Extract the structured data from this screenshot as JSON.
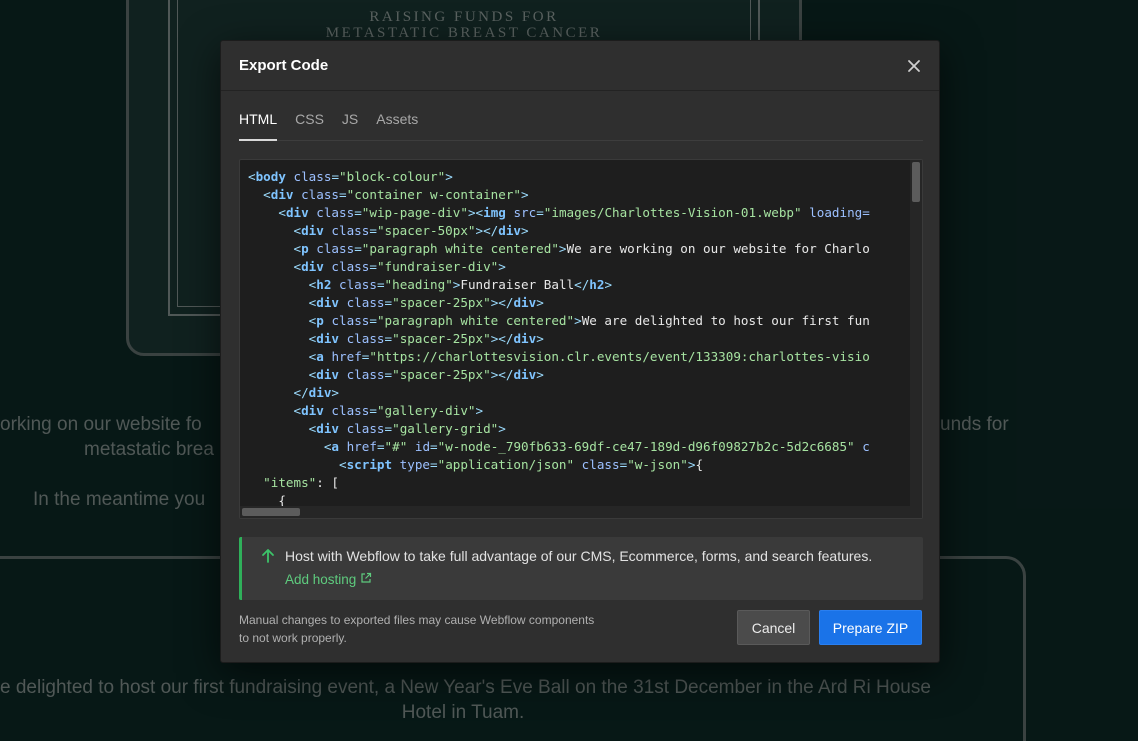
{
  "background": {
    "poster_line1": "RAISING FUNDS FOR",
    "poster_line2": "METASTATIC BREAST CANCER",
    "left_line1": "orking on our website fo",
    "left_line2": "metastatic brea",
    "left_line3": "In the meantime you",
    "right_line1": "unds for",
    "bottom_line1": "e delighted to host our first fundraising event, a New Year's Eve Ball on the 31st December in the Ard Ri House",
    "bottom_line2": "Hotel in Tuam."
  },
  "modal": {
    "title": "Export Code",
    "close_icon": "close-icon",
    "tabs": [
      {
        "label": "HTML",
        "active": true
      },
      {
        "label": "CSS",
        "active": false
      },
      {
        "label": "JS",
        "active": false
      },
      {
        "label": "Assets",
        "active": false
      }
    ],
    "code_lines": [
      [
        [
          "pu",
          "<"
        ],
        [
          "tg",
          "body"
        ],
        [
          "at",
          " class"
        ],
        [
          "pu",
          "="
        ],
        [
          "st",
          "\"block-colour\""
        ],
        [
          "pu",
          ">"
        ]
      ],
      [
        [
          "tx",
          "  "
        ],
        [
          "pu",
          "<"
        ],
        [
          "tg",
          "div"
        ],
        [
          "at",
          " class"
        ],
        [
          "pu",
          "="
        ],
        [
          "st",
          "\"container w-container\""
        ],
        [
          "pu",
          ">"
        ]
      ],
      [
        [
          "tx",
          "    "
        ],
        [
          "pu",
          "<"
        ],
        [
          "tg",
          "div"
        ],
        [
          "at",
          " class"
        ],
        [
          "pu",
          "="
        ],
        [
          "st",
          "\"wip-page-div\""
        ],
        [
          "pu",
          "><"
        ],
        [
          "tg",
          "img"
        ],
        [
          "at",
          " src"
        ],
        [
          "pu",
          "="
        ],
        [
          "st",
          "\"images/Charlottes-Vision-01.webp\""
        ],
        [
          "at",
          " loading="
        ]
      ],
      [
        [
          "tx",
          "      "
        ],
        [
          "pu",
          "<"
        ],
        [
          "tg",
          "div"
        ],
        [
          "at",
          " class"
        ],
        [
          "pu",
          "="
        ],
        [
          "st",
          "\"spacer-50px\""
        ],
        [
          "pu",
          "></"
        ],
        [
          "tg",
          "div"
        ],
        [
          "pu",
          ">"
        ]
      ],
      [
        [
          "tx",
          "      "
        ],
        [
          "pu",
          "<"
        ],
        [
          "tg",
          "p"
        ],
        [
          "at",
          " class"
        ],
        [
          "pu",
          "="
        ],
        [
          "st",
          "\"paragraph white centered\""
        ],
        [
          "pu",
          ">"
        ],
        [
          "tx",
          "We are working on our website for Charlo"
        ]
      ],
      [
        [
          "tx",
          "      "
        ],
        [
          "pu",
          "<"
        ],
        [
          "tg",
          "div"
        ],
        [
          "at",
          " class"
        ],
        [
          "pu",
          "="
        ],
        [
          "st",
          "\"fundraiser-div\""
        ],
        [
          "pu",
          ">"
        ]
      ],
      [
        [
          "tx",
          "        "
        ],
        [
          "pu",
          "<"
        ],
        [
          "tg",
          "h2"
        ],
        [
          "at",
          " class"
        ],
        [
          "pu",
          "="
        ],
        [
          "st",
          "\"heading\""
        ],
        [
          "pu",
          ">"
        ],
        [
          "tx",
          "Fundraiser Ball"
        ],
        [
          "pu",
          "</"
        ],
        [
          "tg",
          "h2"
        ],
        [
          "pu",
          ">"
        ]
      ],
      [
        [
          "tx",
          "        "
        ],
        [
          "pu",
          "<"
        ],
        [
          "tg",
          "div"
        ],
        [
          "at",
          " class"
        ],
        [
          "pu",
          "="
        ],
        [
          "st",
          "\"spacer-25px\""
        ],
        [
          "pu",
          "></"
        ],
        [
          "tg",
          "div"
        ],
        [
          "pu",
          ">"
        ]
      ],
      [
        [
          "tx",
          "        "
        ],
        [
          "pu",
          "<"
        ],
        [
          "tg",
          "p"
        ],
        [
          "at",
          " class"
        ],
        [
          "pu",
          "="
        ],
        [
          "st",
          "\"paragraph white centered\""
        ],
        [
          "pu",
          ">"
        ],
        [
          "tx",
          "We are delighted to host our first fun"
        ]
      ],
      [
        [
          "tx",
          "        "
        ],
        [
          "pu",
          "<"
        ],
        [
          "tg",
          "div"
        ],
        [
          "at",
          " class"
        ],
        [
          "pu",
          "="
        ],
        [
          "st",
          "\"spacer-25px\""
        ],
        [
          "pu",
          "></"
        ],
        [
          "tg",
          "div"
        ],
        [
          "pu",
          ">"
        ]
      ],
      [
        [
          "tx",
          "        "
        ],
        [
          "pu",
          "<"
        ],
        [
          "tg",
          "a"
        ],
        [
          "at",
          " href"
        ],
        [
          "pu",
          "="
        ],
        [
          "st",
          "\"https://charlottesvision.clr.events/event/133309:charlottes-visio"
        ]
      ],
      [
        [
          "tx",
          "        "
        ],
        [
          "pu",
          "<"
        ],
        [
          "tg",
          "div"
        ],
        [
          "at",
          " class"
        ],
        [
          "pu",
          "="
        ],
        [
          "st",
          "\"spacer-25px\""
        ],
        [
          "pu",
          "></"
        ],
        [
          "tg",
          "div"
        ],
        [
          "pu",
          ">"
        ]
      ],
      [
        [
          "tx",
          "      "
        ],
        [
          "pu",
          "</"
        ],
        [
          "tg",
          "div"
        ],
        [
          "pu",
          ">"
        ]
      ],
      [
        [
          "tx",
          "      "
        ],
        [
          "pu",
          "<"
        ],
        [
          "tg",
          "div"
        ],
        [
          "at",
          " class"
        ],
        [
          "pu",
          "="
        ],
        [
          "st",
          "\"gallery-div\""
        ],
        [
          "pu",
          ">"
        ]
      ],
      [
        [
          "tx",
          "        "
        ],
        [
          "pu",
          "<"
        ],
        [
          "tg",
          "div"
        ],
        [
          "at",
          " class"
        ],
        [
          "pu",
          "="
        ],
        [
          "st",
          "\"gallery-grid\""
        ],
        [
          "pu",
          ">"
        ]
      ],
      [
        [
          "tx",
          "          "
        ],
        [
          "pu",
          "<"
        ],
        [
          "tg",
          "a"
        ],
        [
          "at",
          " href"
        ],
        [
          "pu",
          "="
        ],
        [
          "st",
          "\"#\""
        ],
        [
          "at",
          " id"
        ],
        [
          "pu",
          "="
        ],
        [
          "st",
          "\"w-node-_790fb633-69df-ce47-189d-d96f09827b2c-5d2c6685\""
        ],
        [
          "at",
          " c"
        ]
      ],
      [
        [
          "tx",
          "            "
        ],
        [
          "pu",
          "<"
        ],
        [
          "tg",
          "script"
        ],
        [
          "at",
          " type"
        ],
        [
          "pu",
          "="
        ],
        [
          "st",
          "\"application/json\""
        ],
        [
          "at",
          " class"
        ],
        [
          "pu",
          "="
        ],
        [
          "st",
          "\"w-json\""
        ],
        [
          "pu",
          ">"
        ],
        [
          "tx",
          "{"
        ]
      ],
      [
        [
          "tx",
          "  "
        ],
        [
          "st",
          "\"items\""
        ],
        [
          "tx",
          ": ["
        ]
      ],
      [
        [
          "tx",
          "    {"
        ]
      ]
    ],
    "notice": {
      "text": "Host with Webflow to take full advantage of our CMS, Ecommerce, forms, and search features.",
      "link": "Add hosting",
      "icon": "arrow-up-icon",
      "link_icon": "external-link-icon"
    },
    "footer_note": "Manual changes to exported files may cause Webflow components to not work properly.",
    "cancel_label": "Cancel",
    "primary_label": "Prepare ZIP",
    "colors": {
      "accent": "#1a73e8",
      "notice_green": "#2fb05a",
      "link_green": "#5ecb7e"
    }
  }
}
